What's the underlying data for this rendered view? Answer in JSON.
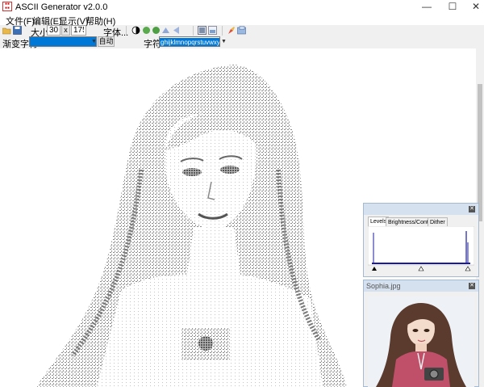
{
  "window": {
    "title": "ASCII Generator v2.0.0",
    "controls": {
      "minimize": "—",
      "maximize": "☐",
      "close": "✕"
    }
  },
  "menu": {
    "items": [
      "文件(F)",
      "编辑(E)",
      "显示(V)",
      "帮助(H)"
    ]
  },
  "toolbar": {
    "size_label": "大小:",
    "width": "300",
    "x_label": "x",
    "height": "175",
    "font_button": "字体..."
  },
  "toolbar2": {
    "ramp_label": "渐变字符:",
    "auto_button": "自动",
    "chars_label": "字符:",
    "chars_value": "ghijklmnopqrstuvwxyz5"
  },
  "levels_panel": {
    "tabs": [
      "Levels",
      "Brightness/Contrast",
      "Dither"
    ],
    "active_tab": "Levels"
  },
  "image_panel": {
    "title": "Sophia.jpg"
  },
  "colors": {
    "accent": "#0078d7",
    "panel_header": "#d6e1ef",
    "ascii_ink": "#6a6a6a"
  }
}
